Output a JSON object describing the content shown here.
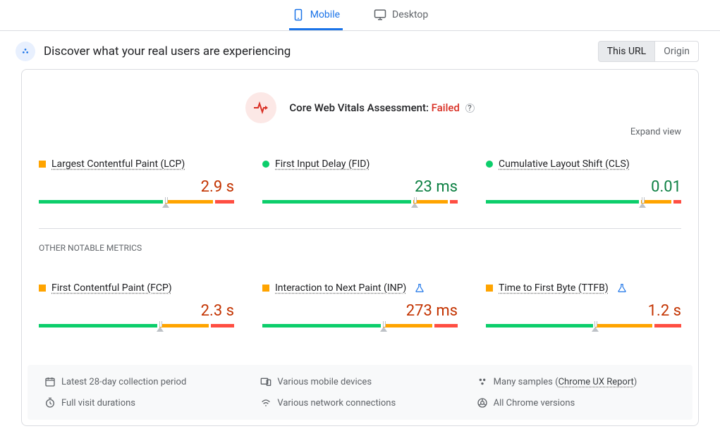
{
  "tabs": {
    "mobile": "Mobile",
    "desktop": "Desktop"
  },
  "header": {
    "title": "Discover what your real users are experiencing",
    "segment": {
      "thisUrl": "This URL",
      "origin": "Origin"
    }
  },
  "cwv": {
    "label": "Core Web Vitals Assessment: ",
    "status": "Failed",
    "expand": "Expand view"
  },
  "metrics_core": [
    {
      "name": "Largest Contentful Paint (LCP)",
      "value": "2.9 s",
      "status": "orange",
      "marker_shape": "square",
      "bar": [
        65,
        25,
        10
      ],
      "pointer": 65
    },
    {
      "name": "First Input Delay (FID)",
      "value": "23 ms",
      "status": "green",
      "marker_shape": "dot",
      "bar": [
        78,
        18,
        4
      ],
      "pointer": 78
    },
    {
      "name": "Cumulative Layout Shift (CLS)",
      "value": "0.01",
      "status": "green",
      "marker_shape": "dot",
      "bar": [
        80,
        16,
        4
      ],
      "pointer": 80
    }
  ],
  "other_label": "OTHER NOTABLE METRICS",
  "metrics_other": [
    {
      "name": "First Contentful Paint (FCP)",
      "value": "2.3 s",
      "status": "orange",
      "experimental": false,
      "bar": [
        62,
        26,
        12
      ],
      "pointer": 62
    },
    {
      "name": "Interaction to Next Paint (INP)",
      "value": "273 ms",
      "status": "orange",
      "experimental": true,
      "bar": [
        62,
        26,
        12
      ],
      "pointer": 62
    },
    {
      "name": "Time to First Byte (TTFB)",
      "value": "1.2 s",
      "status": "orange",
      "experimental": true,
      "bar": [
        56,
        30,
        14
      ],
      "pointer": 56
    }
  ],
  "footer": {
    "a": "Latest 28-day collection period",
    "b": "Various mobile devices",
    "c_prefix": "Many samples (",
    "c_link": "Chrome UX Report",
    "c_suffix": ")",
    "d": "Full visit durations",
    "e": "Various network connections",
    "f": "All Chrome versions"
  }
}
